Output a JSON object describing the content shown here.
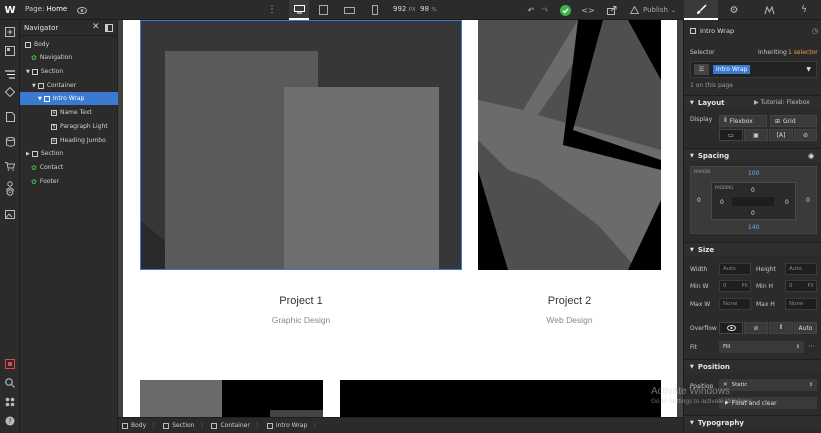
{
  "topbar": {
    "logo": "W",
    "page_label": "Page:",
    "page_name": "Home",
    "width_value": "992",
    "width_unit": "PX",
    "zoom_value": "98",
    "zoom_unit": "%",
    "publish_label": "Publish"
  },
  "navigator": {
    "title": "Navigator",
    "items": [
      {
        "label": "Body"
      },
      {
        "label": "Navigation"
      },
      {
        "label": "Section"
      },
      {
        "label": "Container"
      },
      {
        "label": "Intro Wrap"
      },
      {
        "label": "Name Text"
      },
      {
        "label": "Paragraph Light"
      },
      {
        "label": "Heading Jumbo"
      },
      {
        "label": "Section"
      },
      {
        "label": "Contact"
      },
      {
        "label": "Footer"
      }
    ]
  },
  "canvas": {
    "projects": [
      {
        "title": "Project 1",
        "subtitle": "Graphic Design"
      },
      {
        "title": "Project 2",
        "subtitle": "Web Design"
      }
    ]
  },
  "breadcrumb": [
    "Body",
    "Section",
    "Container",
    "Intro Wrap"
  ],
  "panel": {
    "element_name": "Intro Wrap",
    "selector_label": "Selector",
    "inheriting_label": "Inheriting",
    "selector_count": "1 selector",
    "class_name": "Intro Wrap",
    "on_page": "1 on this page",
    "layout": {
      "title": "Layout",
      "tutorial": "Tutorial: Flexbox",
      "display_label": "Display",
      "flexbox": "Flexbox",
      "grid": "Grid"
    },
    "spacing": {
      "title": "Spacing",
      "margin_label": "MARGIN",
      "padding_label": "PADDING",
      "margin_top": "100",
      "margin_bottom": "140",
      "margin_left": "0",
      "margin_right": "0",
      "padding_top": "0",
      "padding_bottom": "0",
      "padding_left": "0",
      "padding_right": "0"
    },
    "size": {
      "title": "Size",
      "width_label": "Width",
      "width_value": "Auto",
      "height_label": "Height",
      "height_value": "Auto",
      "minw_label": "Min W",
      "minw_value": "0",
      "minw_unit": "PX",
      "minh_label": "Min H",
      "minh_value": "0",
      "minh_unit": "PX",
      "maxw_label": "Max W",
      "maxw_value": "None",
      "maxh_label": "Max H",
      "maxh_value": "None",
      "overflow_label": "Overflow",
      "overflow_auto": "Auto",
      "fit_label": "Fit",
      "fit_value": "Fill"
    },
    "position": {
      "title": "Position",
      "position_label": "Position",
      "position_value": "Static",
      "float_label": "Float and clear"
    },
    "typography": {
      "title": "Typography"
    }
  },
  "watermark": {
    "line1": "Activate Windows",
    "line2": "Go to Settings to activate Windows."
  },
  "colors": {
    "accent": "#3c7ad2",
    "selector_orange": "#e9a33a",
    "publish_green": "#3ab54a"
  }
}
